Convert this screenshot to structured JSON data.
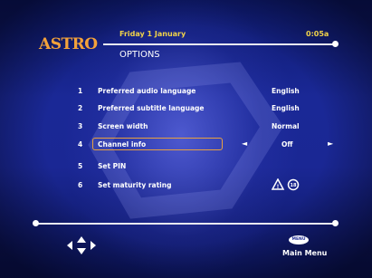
{
  "header": {
    "logo": "ASTRO",
    "date": "Friday 1 January",
    "time": "0:05a",
    "title": "OPTIONS"
  },
  "options": [
    {
      "num": "1",
      "label": "Preferred audio language",
      "value": "English"
    },
    {
      "num": "2",
      "label": "Preferred subtitle language",
      "value": "English"
    },
    {
      "num": "3",
      "label": "Screen width",
      "value": "Normal"
    },
    {
      "num": "4",
      "label": "Channel info",
      "value": "Off",
      "selected": true
    },
    {
      "num": "5",
      "label": "Set PIN",
      "value": ""
    },
    {
      "num": "6",
      "label": "Set maturity rating",
      "value": "",
      "rating_badges": [
        "warning-triangle-icon",
        "18"
      ]
    }
  ],
  "selection_arrows": {
    "left": "◄",
    "right": "►"
  },
  "footer": {
    "nav_icon": "directional-pad-icon",
    "menu_button": "MENU",
    "menu_label": "Main Menu"
  },
  "colors": {
    "accent": "#f3a23a",
    "header_text": "#f0d24a",
    "selection_border": "#e8a040",
    "background": "#1a2894"
  }
}
